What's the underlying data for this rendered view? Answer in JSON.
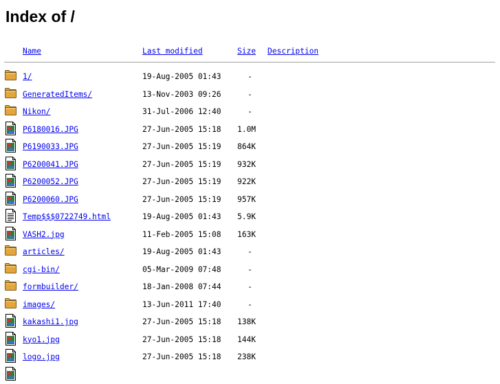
{
  "page": {
    "title": "Index of /"
  },
  "columns": {
    "name": "Name",
    "last_modified": "Last modified",
    "size": "Size",
    "description": "Description"
  },
  "colors": {
    "link": "#0000ee",
    "folder": "#e4a63c",
    "rule": "#a0a0a0"
  },
  "entries": [
    {
      "name": "1/",
      "modified": "19-Aug-2005 01:43",
      "size": "-",
      "icon": "folder-icon"
    },
    {
      "name": "GeneratedItems/",
      "modified": "13-Nov-2003 09:26",
      "size": "-",
      "icon": "folder-icon"
    },
    {
      "name": "Nikon/",
      "modified": "31-Jul-2006 12:40",
      "size": "-",
      "icon": "folder-icon"
    },
    {
      "name": "P6180016.JPG",
      "modified": "27-Jun-2005 15:18",
      "size": "1.0M",
      "icon": "image-file-icon"
    },
    {
      "name": "P6190033.JPG",
      "modified": "27-Jun-2005 15:19",
      "size": "864K",
      "icon": "image-file-icon"
    },
    {
      "name": "P6200041.JPG",
      "modified": "27-Jun-2005 15:19",
      "size": "932K",
      "icon": "image-file-icon"
    },
    {
      "name": "P6200052.JPG",
      "modified": "27-Jun-2005 15:19",
      "size": "922K",
      "icon": "image-file-icon"
    },
    {
      "name": "P6200060.JPG",
      "modified": "27-Jun-2005 15:19",
      "size": "957K",
      "icon": "image-file-icon"
    },
    {
      "name": "Temp$$$0722749.html",
      "modified": "19-Aug-2005 01:43",
      "size": "5.9K",
      "icon": "text-file-icon"
    },
    {
      "name": "VASH2.jpg",
      "modified": "11-Feb-2005 15:08",
      "size": "163K",
      "icon": "image-file-icon"
    },
    {
      "name": "articles/",
      "modified": "19-Aug-2005 01:43",
      "size": "-",
      "icon": "folder-icon"
    },
    {
      "name": "cgi-bin/",
      "modified": "05-Mar-2009 07:48",
      "size": "-",
      "icon": "folder-icon"
    },
    {
      "name": "formbuilder/",
      "modified": "18-Jan-2008 07:44",
      "size": "-",
      "icon": "folder-icon"
    },
    {
      "name": "images/",
      "modified": "13-Jun-2011 17:40",
      "size": "-",
      "icon": "folder-icon"
    },
    {
      "name": "kakashi1.jpg",
      "modified": "27-Jun-2005 15:18",
      "size": "138K",
      "icon": "image-file-icon"
    },
    {
      "name": "kyo1.jpg",
      "modified": "27-Jun-2005 15:18",
      "size": "144K",
      "icon": "image-file-icon"
    },
    {
      "name": "logo.jpg",
      "modified": "27-Jun-2005 15:18",
      "size": "238K",
      "icon": "image-file-icon"
    },
    {
      "name": "",
      "modified": "",
      "size": "",
      "icon": "image-file-icon"
    }
  ]
}
